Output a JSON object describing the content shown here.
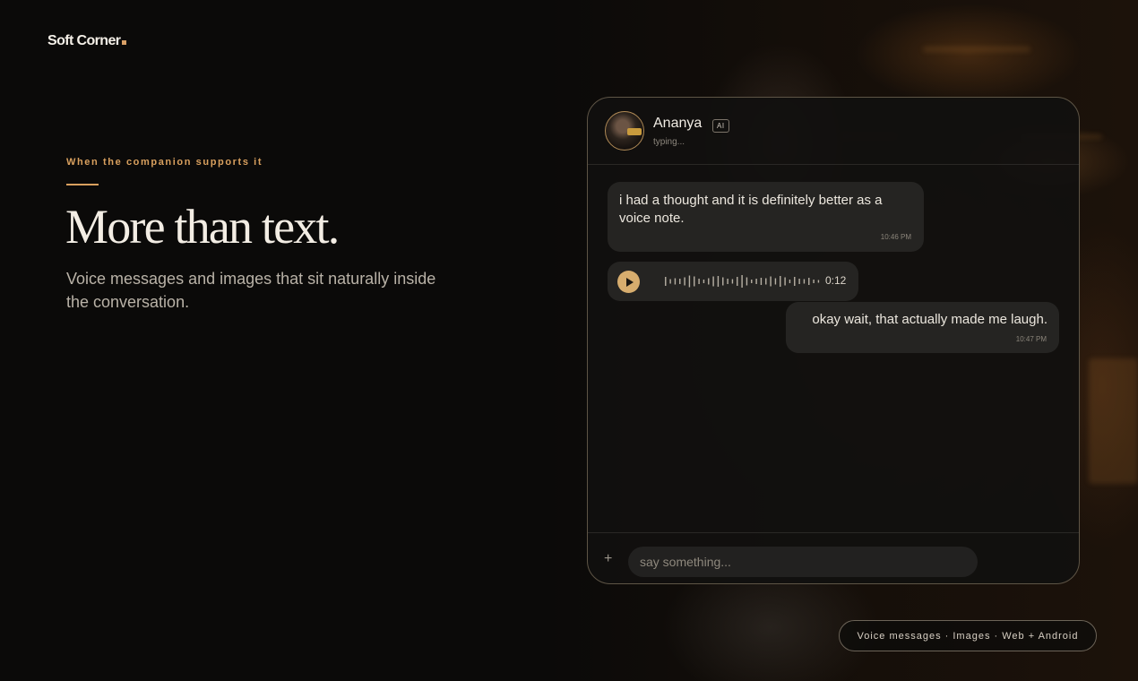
{
  "brand": {
    "name": "Soft Corner"
  },
  "hero": {
    "eyebrow": "When the companion supports it",
    "headline": "More than text.",
    "subcopy": "Voice messages and images that sit naturally inside the conversation."
  },
  "chat": {
    "contact": {
      "name": "Ananya",
      "badge": "AI",
      "status": "typing..."
    },
    "messages": [
      {
        "from": "companion",
        "text": "i had a thought and it is definitely better as a voice note.",
        "time": "10:46 PM"
      },
      {
        "from": "companion",
        "type": "voice",
        "duration": "0:12",
        "waveform": [
          0.5,
          0.25,
          0.35,
          0.3,
          0.45,
          0.65,
          0.55,
          0.3,
          0.2,
          0.35,
          0.55,
          0.6,
          0.45,
          0.3,
          0.25,
          0.5,
          0.7,
          0.45,
          0.2,
          0.3,
          0.4,
          0.35,
          0.55,
          0.35,
          0.6,
          0.45,
          0.2,
          0.5,
          0.3,
          0.25,
          0.4,
          0.2,
          0.15
        ]
      },
      {
        "from": "user",
        "text": "okay wait, that actually made me laugh.",
        "time": "10:47 PM"
      }
    ],
    "composer": {
      "placeholder": "say something...",
      "value": ""
    }
  },
  "features": {
    "label": "Voice messages · Images · Web + Android"
  },
  "colors": {
    "accent": "#d9a05e",
    "play_button": "#d7ad6e",
    "bubble": "#252422",
    "background": "#0b0a09"
  },
  "icons": {
    "play": "play-icon",
    "attach": "plus-icon"
  }
}
